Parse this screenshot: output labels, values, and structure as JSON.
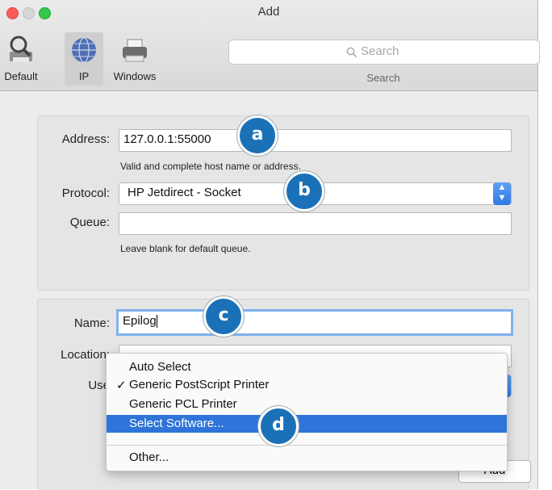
{
  "window": {
    "title": "Add"
  },
  "toolbar": {
    "buttons": [
      {
        "label": "Default"
      },
      {
        "label": "IP"
      },
      {
        "label": "Windows"
      }
    ],
    "search": {
      "placeholder": "Search",
      "caption": "Search"
    }
  },
  "ip_panel": {
    "address_label": "Address:",
    "address_value": "127.0.0.1:55000",
    "address_hint": "Valid and complete host name or address.",
    "protocol_label": "Protocol:",
    "protocol_value": "HP Jetdirect - Socket",
    "queue_label": "Queue:",
    "queue_value": "",
    "queue_hint": "Leave blank for default queue."
  },
  "details_panel": {
    "name_label": "Name:",
    "name_value": "Epilog",
    "location_label": "Location:",
    "use_label": "Use"
  },
  "use_menu": {
    "items": [
      {
        "label": "Auto Select",
        "checked": false
      },
      {
        "label": "Generic PostScript Printer",
        "checked": true
      },
      {
        "label": "Generic PCL Printer",
        "checked": false
      },
      {
        "label": "Select Software...",
        "checked": false,
        "highlighted": true
      },
      {
        "label": "Other...",
        "checked": false
      }
    ],
    "check_glyph": "✓"
  },
  "footer": {
    "add_label": "Add"
  },
  "callouts": {
    "a": "a",
    "b": "b",
    "c": "c",
    "d": "d"
  },
  "colors": {
    "callout": "#1b71b8",
    "highlight": "#2f74d8",
    "focus_ring": "#7fb0ee"
  }
}
